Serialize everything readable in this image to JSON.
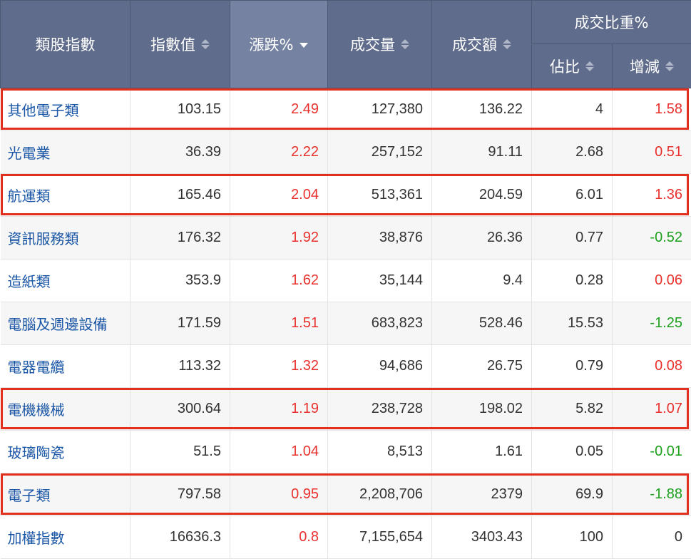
{
  "header": {
    "name": "類股指數",
    "index_value": "指數值",
    "change_pct": "漲跌%",
    "volume": "成交量",
    "amount": "成交額",
    "ratio_group": "成交比重%",
    "ratio": "佔比",
    "ratio_change": "增減"
  },
  "rows": [
    {
      "name": "其他電子類",
      "index": "103.15",
      "change": "2.49",
      "volume": "127,380",
      "amount": "136.22",
      "ratio": "4",
      "delta": "1.58",
      "delta_dir": "up",
      "highlighted": true
    },
    {
      "name": "光電業",
      "index": "36.39",
      "change": "2.22",
      "volume": "257,152",
      "amount": "91.11",
      "ratio": "2.68",
      "delta": "0.51",
      "delta_dir": "up",
      "highlighted": false
    },
    {
      "name": "航運類",
      "index": "165.46",
      "change": "2.04",
      "volume": "513,361",
      "amount": "204.59",
      "ratio": "6.01",
      "delta": "1.36",
      "delta_dir": "up",
      "highlighted": true
    },
    {
      "name": "資訊服務類",
      "index": "176.32",
      "change": "1.92",
      "volume": "38,876",
      "amount": "26.36",
      "ratio": "0.77",
      "delta": "-0.52",
      "delta_dir": "dn",
      "highlighted": false
    },
    {
      "name": "造紙類",
      "index": "353.9",
      "change": "1.62",
      "volume": "35,144",
      "amount": "9.4",
      "ratio": "0.28",
      "delta": "0.06",
      "delta_dir": "up",
      "highlighted": false
    },
    {
      "name": "電腦及週邊設備",
      "index": "171.59",
      "change": "1.51",
      "volume": "683,823",
      "amount": "528.46",
      "ratio": "15.53",
      "delta": "-1.25",
      "delta_dir": "dn",
      "highlighted": false
    },
    {
      "name": "電器電纜",
      "index": "113.32",
      "change": "1.32",
      "volume": "94,686",
      "amount": "26.75",
      "ratio": "0.79",
      "delta": "0.08",
      "delta_dir": "up",
      "highlighted": false
    },
    {
      "name": "電機機械",
      "index": "300.64",
      "change": "1.19",
      "volume": "238,728",
      "amount": "198.02",
      "ratio": "5.82",
      "delta": "1.07",
      "delta_dir": "up",
      "highlighted": true
    },
    {
      "name": "玻璃陶瓷",
      "index": "51.5",
      "change": "1.04",
      "volume": "8,513",
      "amount": "1.61",
      "ratio": "0.05",
      "delta": "-0.01",
      "delta_dir": "dn",
      "highlighted": false
    },
    {
      "name": "電子類",
      "index": "797.58",
      "change": "0.95",
      "volume": "2,208,706",
      "amount": "2379",
      "ratio": "69.9",
      "delta": "-1.88",
      "delta_dir": "dn",
      "highlighted": true
    },
    {
      "name": "加權指數",
      "index": "16636.3",
      "change": "0.8",
      "volume": "7,155,654",
      "amount": "3403.43",
      "ratio": "100",
      "delta": "0",
      "delta_dir": "neutral",
      "highlighted": false
    }
  ],
  "colors": {
    "header_bg": "#5f6c8b",
    "header_sorted_bg": "#7682a1",
    "positive": "#e8312e",
    "negative": "#1ea01e",
    "link": "#1a56a6",
    "highlight_border": "#e2301f"
  },
  "sort": {
    "column": "change_pct",
    "direction": "desc"
  }
}
